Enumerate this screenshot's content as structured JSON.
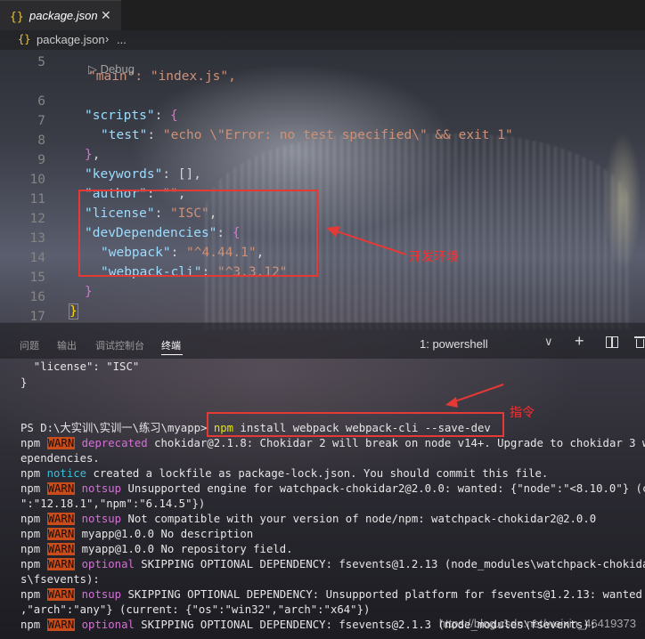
{
  "tab": {
    "icon": "{}",
    "label": "package.json",
    "close": "✕"
  },
  "breadcrumb": {
    "icon": "{}",
    "file": "package.json",
    "sep": "›",
    "more": "..."
  },
  "editor": {
    "codelens": "▷ Debug",
    "partial_line5": "\"main\": \"index.js\",",
    "line_numbers": [
      "5",
      "6",
      "7",
      "8",
      "9",
      "10",
      "11",
      "12",
      "13",
      "14",
      "15",
      "16",
      "17"
    ],
    "lines": [
      {
        "key": "\"scripts\"",
        "rest": ": {"
      },
      {
        "key": "\"test\"",
        "rest": ": ",
        "val": "\"echo \\\"Error: no test specified\\\" && exit 1\""
      },
      {
        "key": "",
        "rest": "},"
      },
      {
        "key": "\"keywords\"",
        "rest": ": [],"
      },
      {
        "key": "\"author\"",
        "rest": ": ",
        "val": "\"\"",
        "tail": ","
      },
      {
        "key": "\"license\"",
        "rest": ": ",
        "val": "\"ISC\"",
        "tail": ","
      },
      {
        "key": "\"devDependencies\"",
        "rest": ": {"
      },
      {
        "key": "\"webpack\"",
        "rest": ": ",
        "val": "\"^4.44.1\"",
        "tail": ","
      },
      {
        "key": "\"webpack-cli\"",
        "rest": ": ",
        "val": "\"^3.3.12\""
      },
      {
        "key": "",
        "rest": "}"
      },
      {
        "key": "",
        "rest": "}"
      }
    ]
  },
  "annotations": {
    "dev_env": "开发环境",
    "command": "指令"
  },
  "panel": {
    "tabs": [
      "问题",
      "输出",
      "调试控制台",
      "终端"
    ],
    "active_tab": "终端",
    "terminal_select": "1: powershell",
    "chevron": "∨",
    "plus": "+"
  },
  "terminal": {
    "l1": "  \"license\": \"ISC\"",
    "l2": "}",
    "prompt": "PS D:\\大实训\\实训一\\练习\\myapp> ",
    "cmd_npm": "npm",
    "cmd_rest": " install webpack webpack-cli --save-dev",
    "npm": "npm",
    "warn": "WARN",
    "w1_tag": "deprecated",
    "w1": " chokidar@2.1.8: Chokidar 2 will break on node v14+. Upgrade to chokidar 3 with 1",
    "w1b": "ependencies.",
    "notice_tag": "notice",
    "notice": " created a lockfile as package-lock.json. You should commit this file.",
    "ns_tag": "notsup",
    "ns1": " Unsupported engine for watchpack-chokidar2@2.0.0: wanted: {\"node\":\"<8.10.0\"} (curren",
    "ns1b": "\":\"12.18.1\",\"npm\":\"6.14.5\"})",
    "ns2": " Not compatible with your version of node/npm: watchpack-chokidar2@2.0.0",
    "m1": " myapp@1.0.0 No description",
    "m2": " myapp@1.0.0 No repository field.",
    "opt_tag": "optional",
    "opt1": " SKIPPING OPTIONAL DEPENDENCY: fsevents@1.2.13 (node_modules\\watchpack-chokidar2\\no",
    "opt1b": "s\\fsevents):",
    "ns3": " SKIPPING OPTIONAL DEPENDENCY: Unsupported platform for fsevents@1.2.13: wanted {\"os\"",
    "ns3b": ",\"arch\":\"any\"} (current: {\"os\":\"win32\",\"arch\":\"x64\"})",
    "opt2": " SKIPPING OPTIONAL DEPENDENCY: fsevents@2.1.3 (node_modules\\fsevents):"
  },
  "watermark": "https://blog.csdn.net/weixin_46419373",
  "colors": {
    "annotation": "#e53935",
    "warn_bg": "#c94c1a",
    "json_key": "#9cdcfe",
    "json_string": "#ce9178"
  }
}
